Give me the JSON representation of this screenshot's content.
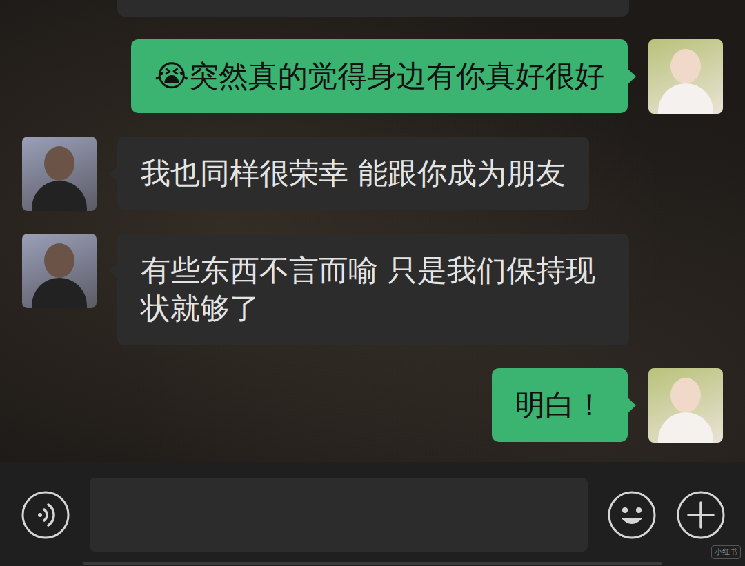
{
  "chat": {
    "messages": [
      {
        "kind": "sent",
        "text": "😭突然真的觉得身边有你真好很好"
      },
      {
        "kind": "received",
        "text": "我也同样很荣幸 能跟你成为朋友"
      },
      {
        "kind": "received",
        "text": "有些东西不言而喻 只是我们保持现状就够了"
      },
      {
        "kind": "sent",
        "text": "明白！"
      }
    ]
  },
  "watermark": "小红书"
}
